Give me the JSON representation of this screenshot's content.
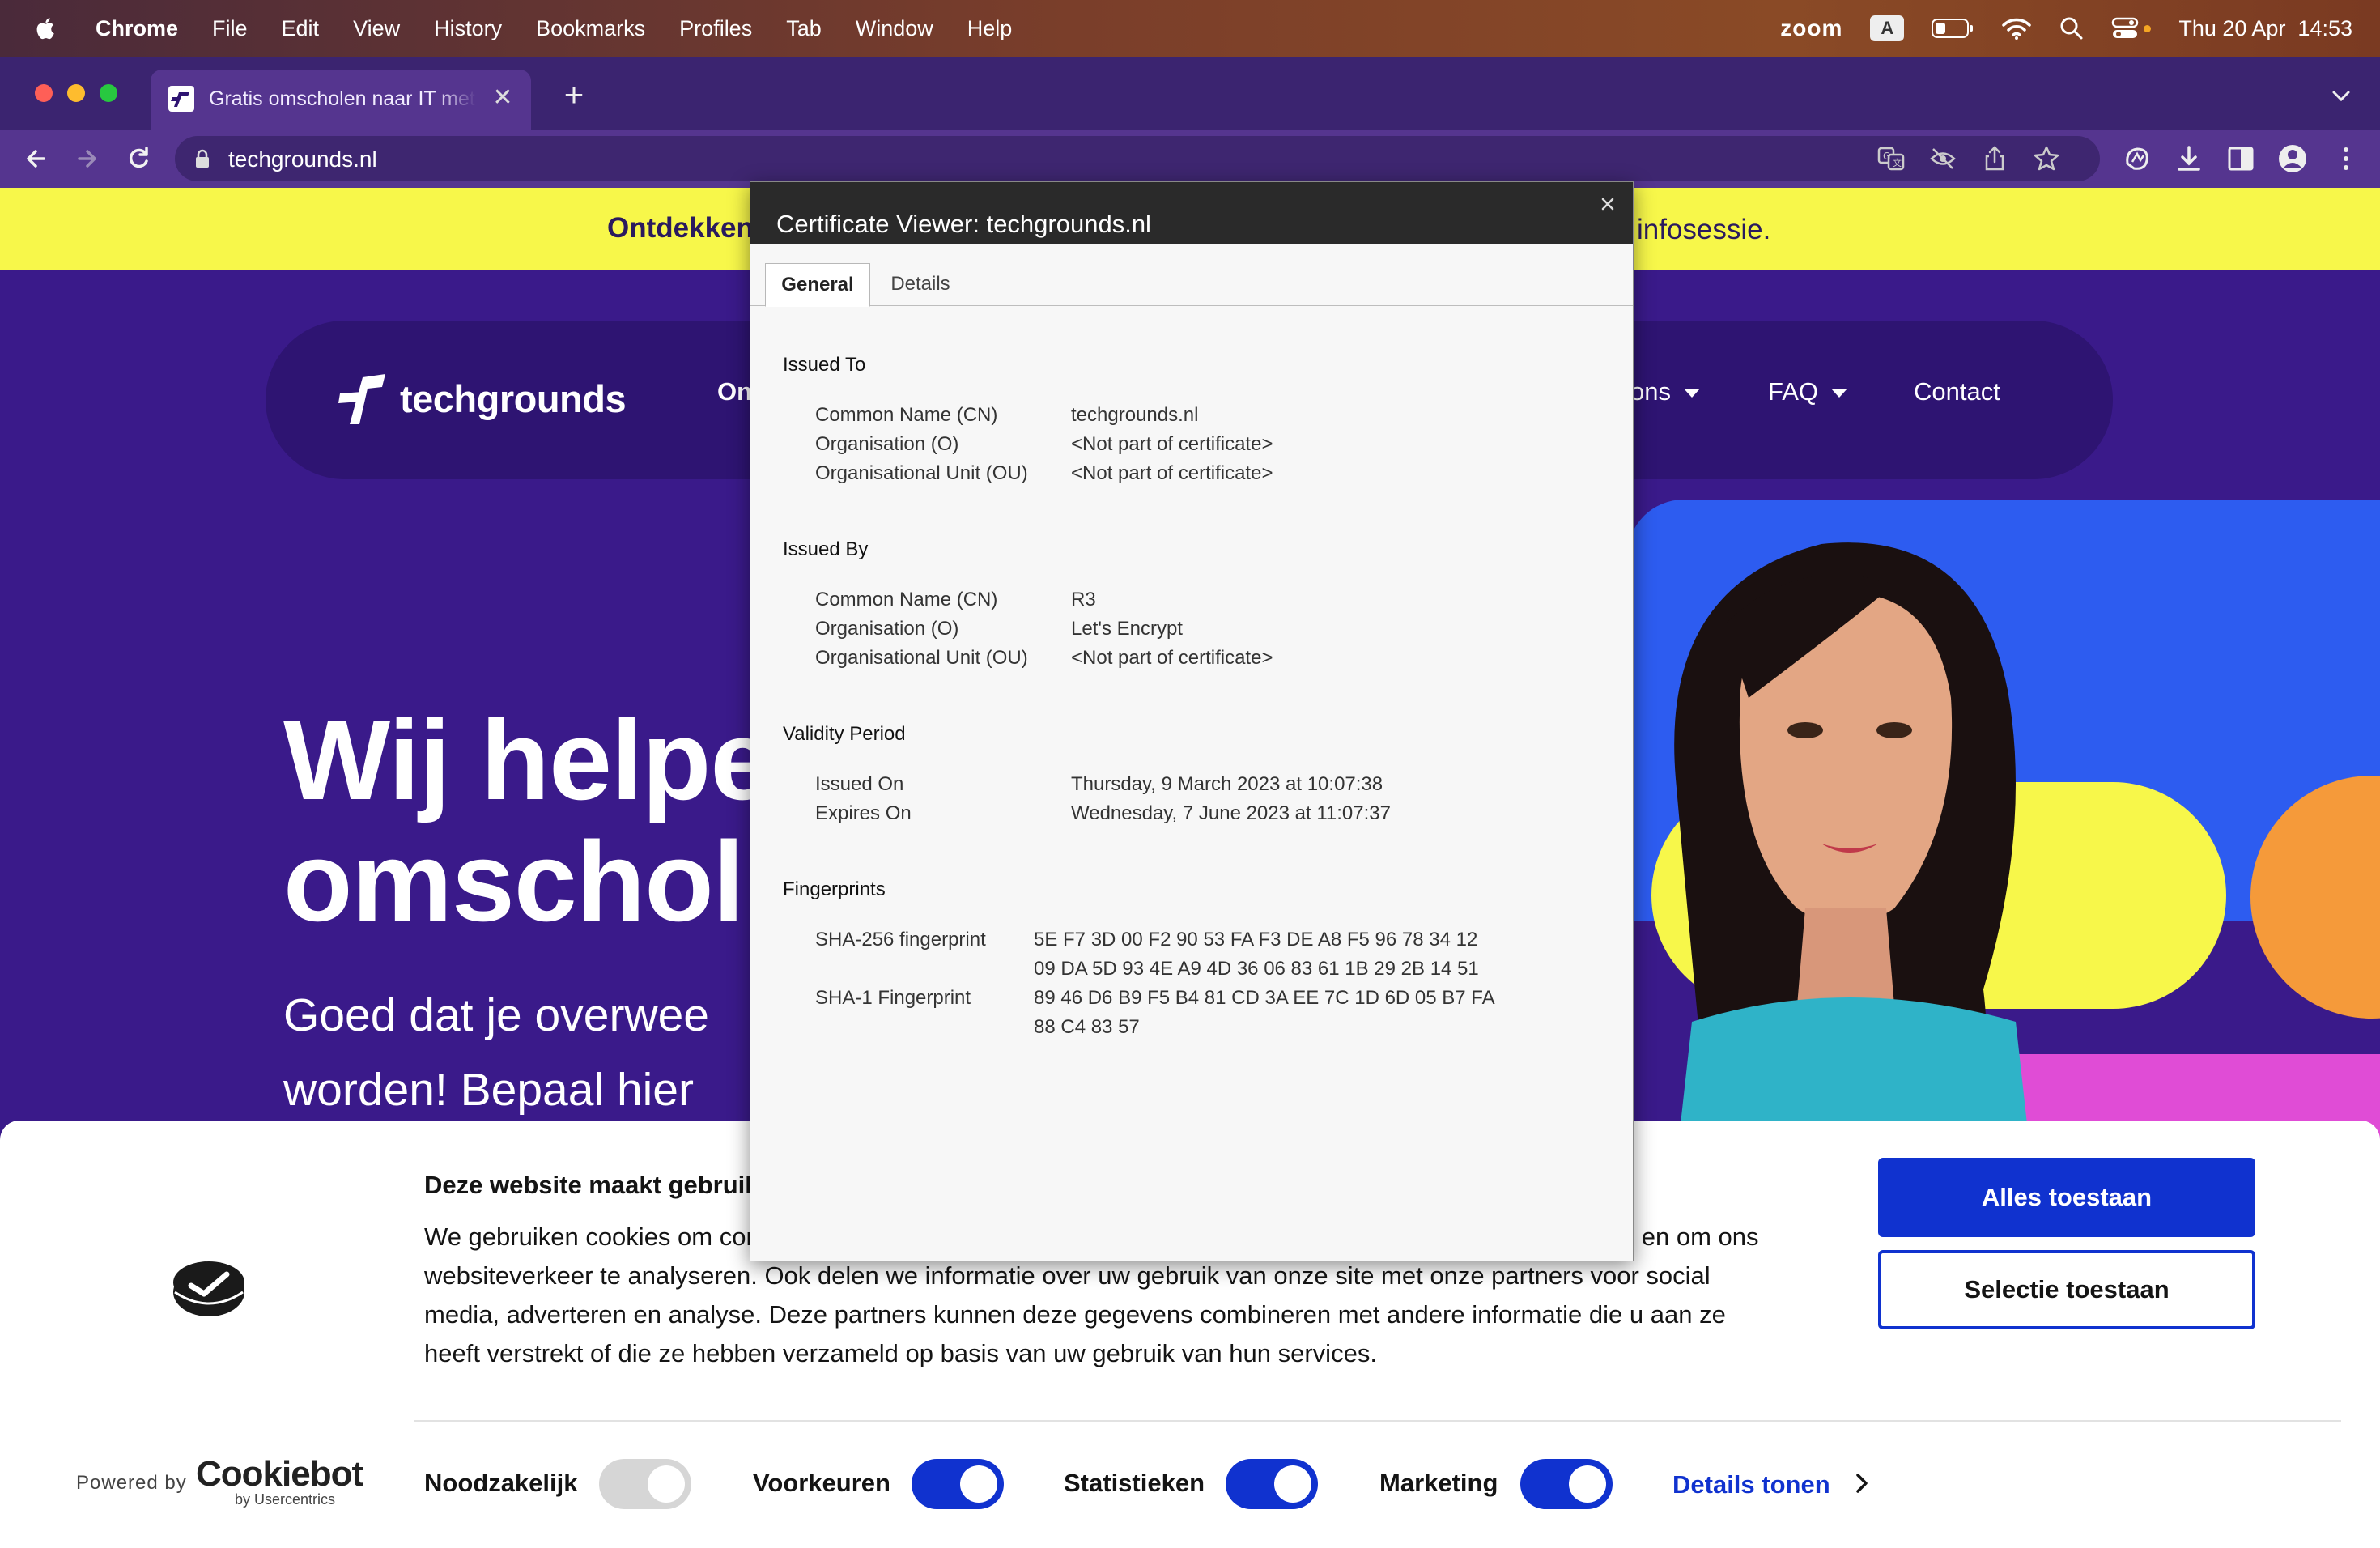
{
  "menubar": {
    "app": "Chrome",
    "items": [
      "File",
      "Edit",
      "View",
      "History",
      "Bookmarks",
      "Profiles",
      "Tab",
      "Window",
      "Help"
    ],
    "zoom": "zoom",
    "input_badge": "A",
    "datetime": "Thu 20 Apr  14:53"
  },
  "browser": {
    "tab_title": "Gratis omscholen naar IT met Techgrounds",
    "new_tab": "+",
    "url": "techgrounds.nl"
  },
  "site": {
    "promo_left": "Ontdekken",
    "promo_right": "infosessie.",
    "logo": "techgrounds",
    "nav_partial": "On",
    "nav": [
      "ons",
      "FAQ",
      "Contact"
    ],
    "hero_title": [
      "Wij helpe",
      "omscholi"
    ],
    "hero_text": [
      "Goed dat je overwee",
      "worden! Bepaal hier"
    ]
  },
  "cookie": {
    "heading": "Deze website maakt gebruik van cookies",
    "body": "We gebruiken cookies om content en advertenties te personaliseren, om functies voor social media te bieden en om ons websiteverkeer te analyseren. Ook delen we informatie over uw gebruik van onze site met onze partners voor social media, adverteren en analyse. Deze partners kunnen deze gegevens combineren met andere informatie die u aan ze heeft verstrekt of die ze hebben verzameld op basis van uw gebruik van hun services.",
    "allow_all": "Alles toestaan",
    "allow_selection": "Selectie toestaan",
    "powered_by": "Powered by",
    "brand": "Cookiebot",
    "brand_sub": "by Usercentrics",
    "toggles": [
      {
        "label": "Noodzakelijk",
        "on": true,
        "disabled": true
      },
      {
        "label": "Voorkeuren",
        "on": true,
        "disabled": false
      },
      {
        "label": "Statistieken",
        "on": true,
        "disabled": false
      },
      {
        "label": "Marketing",
        "on": true,
        "disabled": false
      }
    ],
    "details": "Details tonen"
  },
  "cert": {
    "title": "Certificate Viewer: techgrounds.nl",
    "tabs": [
      "General",
      "Details"
    ],
    "issued_to": {
      "heading": "Issued To",
      "rows": [
        {
          "label": "Common Name (CN)",
          "value": "techgrounds.nl"
        },
        {
          "label": "Organisation (O)",
          "value": "<Not part of certificate>"
        },
        {
          "label": "Organisational Unit (OU)",
          "value": "<Not part of certificate>"
        }
      ]
    },
    "issued_by": {
      "heading": "Issued By",
      "rows": [
        {
          "label": "Common Name (CN)",
          "value": "R3"
        },
        {
          "label": "Organisation (O)",
          "value": "Let's Encrypt"
        },
        {
          "label": "Organisational Unit (OU)",
          "value": "<Not part of certificate>"
        }
      ]
    },
    "validity": {
      "heading": "Validity Period",
      "rows": [
        {
          "label": "Issued On",
          "value": "Thursday, 9 March 2023 at 10:07:38"
        },
        {
          "label": "Expires On",
          "value": "Wednesday, 7 June 2023 at 11:07:37"
        }
      ]
    },
    "fingerprints": {
      "heading": "Fingerprints",
      "sha256_label": "SHA-256 fingerprint",
      "sha256": [
        "5E F7 3D 00 F2 90 53 FA F3 DE A8 F5 96 78 34 12",
        "09 DA 5D 93 4E A9 4D 36 06 83 61 1B 29 2B 14 51"
      ],
      "sha1_label": "SHA-1 Fingerprint",
      "sha1": [
        "89 46 D6 B9 F5 B4 81 CD 3A EE 7C 1D 6D 05 B7 FA",
        "88 C4 83 57"
      ]
    }
  },
  "colors": {
    "site_purple": "#3a1a8a",
    "promo_yellow": "#f7f74a",
    "cookie_blue": "#1032cf"
  }
}
